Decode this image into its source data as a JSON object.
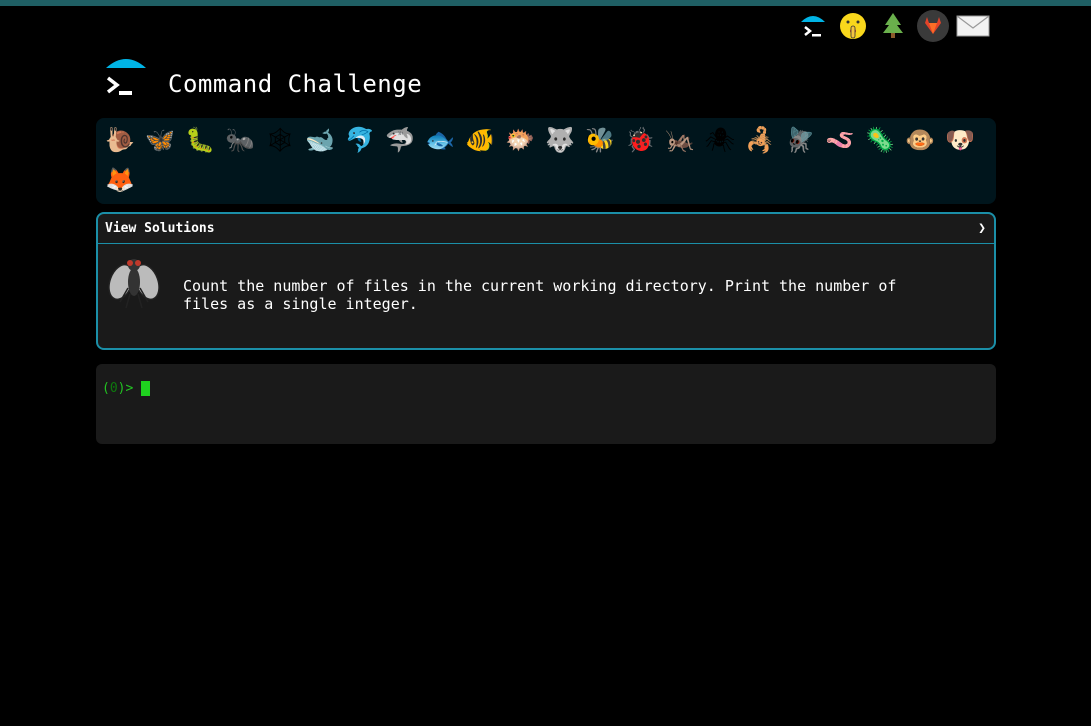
{
  "app": {
    "title": "Command Challenge"
  },
  "header_icons": [
    {
      "name": "terminal-umbrella-icon",
      "glyph": ""
    },
    {
      "name": "shushing-face-icon",
      "glyph": "🤫"
    },
    {
      "name": "tree-icon",
      "glyph": "🌲"
    },
    {
      "name": "gitlab-icon",
      "glyph": "🦊"
    },
    {
      "name": "mail-icon",
      "glyph": "✉"
    }
  ],
  "challenges": [
    {
      "name": "snail-icon",
      "glyph": "🐌"
    },
    {
      "name": "butterfly-icon",
      "glyph": "🦋"
    },
    {
      "name": "caterpillar-icon",
      "glyph": "🐛"
    },
    {
      "name": "ant-icon",
      "glyph": "🐜"
    },
    {
      "name": "spider-web-icon",
      "glyph": "🕸"
    },
    {
      "name": "whale-icon",
      "glyph": "🐋"
    },
    {
      "name": "dolphin-icon",
      "glyph": "🐬"
    },
    {
      "name": "shark-icon",
      "glyph": "🦈"
    },
    {
      "name": "fish-icon",
      "glyph": "🐟"
    },
    {
      "name": "tropical-fish-icon",
      "glyph": "🐠"
    },
    {
      "name": "blowfish-icon",
      "glyph": "🐡"
    },
    {
      "name": "wolf-icon",
      "glyph": "🐺"
    },
    {
      "name": "bee-icon",
      "glyph": "🐝"
    },
    {
      "name": "ladybug-icon",
      "glyph": "🐞"
    },
    {
      "name": "cricket-icon",
      "glyph": "🦗"
    },
    {
      "name": "spider-icon",
      "glyph": "🕷"
    },
    {
      "name": "scorpion-icon",
      "glyph": "🦂"
    },
    {
      "name": "fly-icon",
      "glyph": "🪰"
    },
    {
      "name": "worm-icon",
      "glyph": "🪱"
    },
    {
      "name": "microbe-icon",
      "glyph": "🦠"
    },
    {
      "name": "monkey-icon",
      "glyph": "🐵"
    },
    {
      "name": "dog-icon",
      "glyph": "🐶"
    },
    {
      "name": "fox-icon",
      "glyph": "🦊"
    }
  ],
  "solutions": {
    "label": "View Solutions",
    "chevron": "❯"
  },
  "problem": {
    "icon": "fly-icon",
    "text": "Count the number of files in the current working directory. Print the number of files as a single integer."
  },
  "terminal": {
    "prompt_open": "(",
    "prompt_num": "0",
    "prompt_close": ")>"
  },
  "colors": {
    "accent": "#1b8fa8",
    "logo_cyan": "#00b4e6",
    "prompt_green": "#22c322",
    "background": "#000000",
    "panel": "#1a1a1a"
  }
}
